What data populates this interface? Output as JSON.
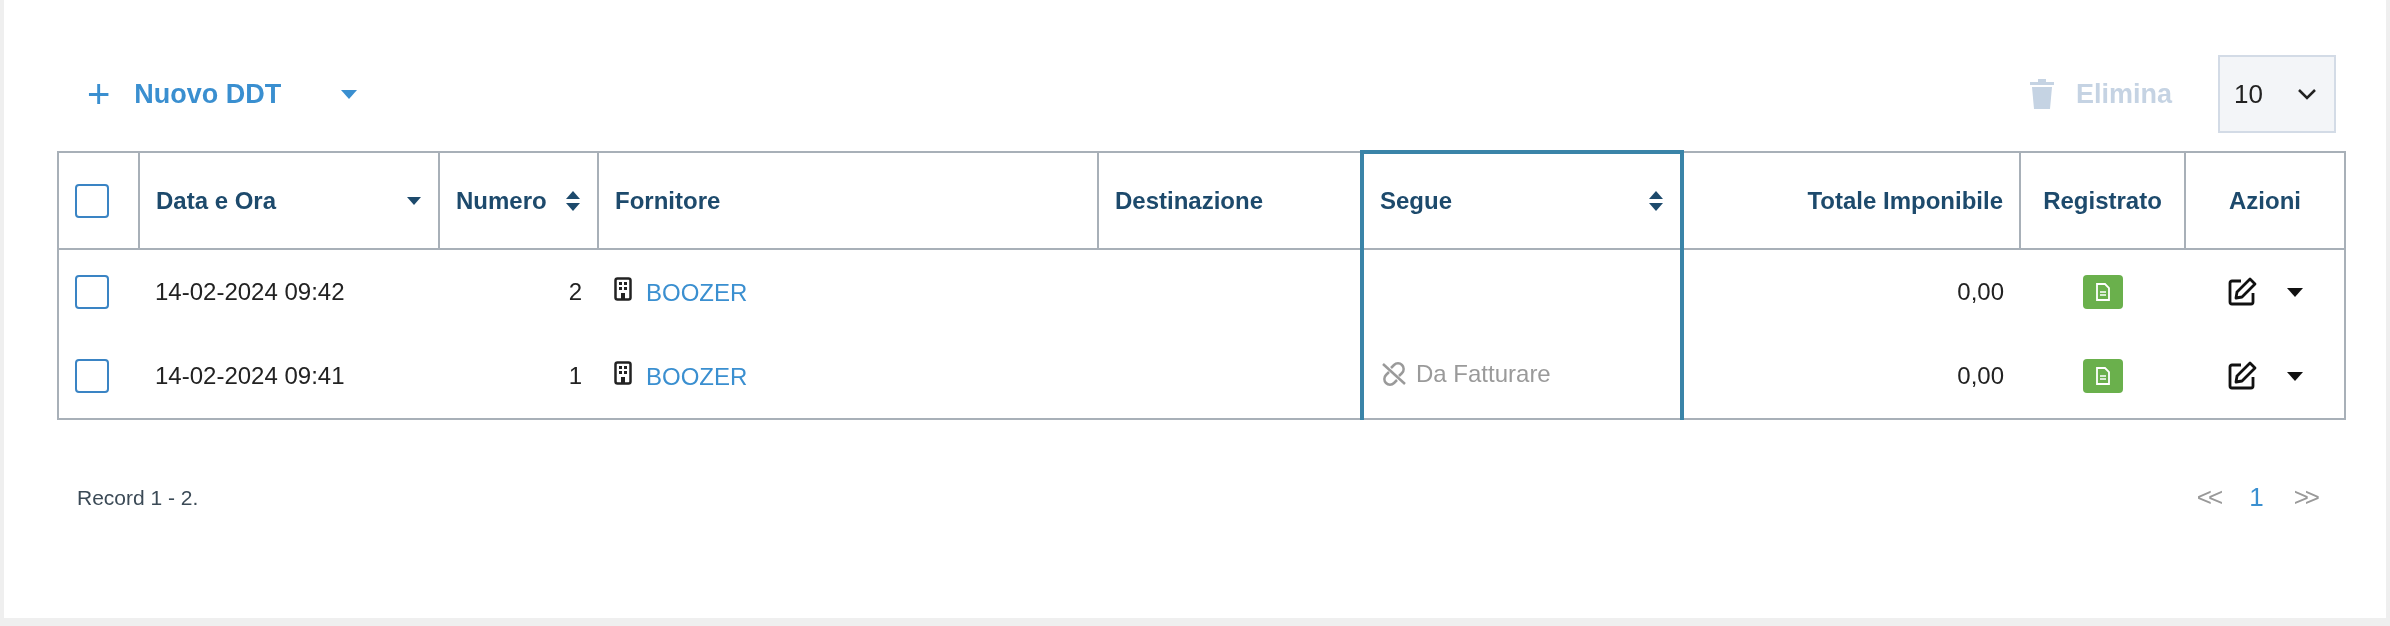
{
  "toolbar": {
    "new_button": {
      "icon": "+",
      "label": "Nuovo DDT"
    },
    "delete_button": {
      "label": "Elimina",
      "disabled": true
    },
    "page_size": {
      "value": "10"
    }
  },
  "table": {
    "select_all": {
      "checked": false
    },
    "columns": [
      {
        "label": "Data e Ora",
        "kind": "text",
        "sort_up": false,
        "sort_down": true,
        "highlighted": false
      },
      {
        "label": "Numero",
        "kind": "text",
        "sort_up": true,
        "sort_down": true,
        "highlighted": false
      },
      {
        "label": "Fornitore",
        "kind": "text",
        "sort_up": false,
        "sort_down": false,
        "highlighted": false
      },
      {
        "label": "Destinazione",
        "kind": "text",
        "sort_up": false,
        "sort_down": false,
        "highlighted": false
      },
      {
        "label": "Segue",
        "kind": "text",
        "sort_up": true,
        "sort_down": true,
        "highlighted": true
      },
      {
        "label": "Totale Imponibile",
        "kind": "amount",
        "sort_up": false,
        "sort_down": false,
        "highlighted": false
      },
      {
        "label": "Registrato",
        "kind": "status",
        "sort_up": false,
        "sort_down": false,
        "highlighted": false
      },
      {
        "label": "Azioni",
        "kind": "status",
        "sort_up": false,
        "sort_down": false,
        "highlighted": false
      }
    ],
    "rows": [
      {
        "checked": false,
        "date": "14-02-2024 09:42",
        "number": "2",
        "supplier": "BOOZER",
        "follows": null,
        "total": "0,00",
        "registered": true
      },
      {
        "checked": false,
        "date": "14-02-2024 09:41",
        "number": "1",
        "supplier": "BOOZER",
        "follows": "Da Fatturare",
        "total": "0,00",
        "registered": true
      }
    ]
  },
  "footer": {
    "record_count": "Record 1 - 2.",
    "pagination": {
      "first": "<<",
      "pages": [
        {
          "label": "1",
          "selected": true
        }
      ],
      "last": ">>"
    }
  }
}
